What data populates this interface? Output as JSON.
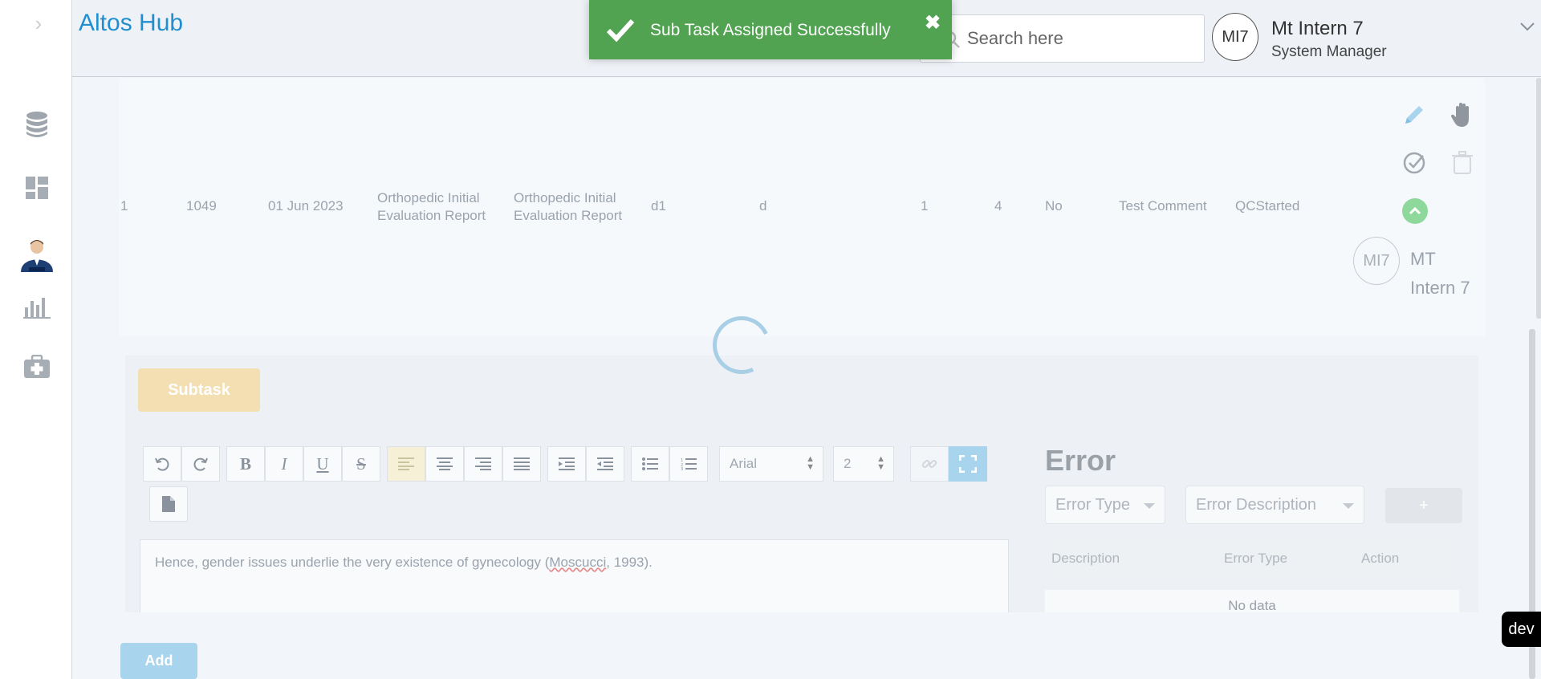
{
  "sidebar": {
    "toggle_icon": "chevron-right-icon",
    "items": [
      {
        "icon": "database-icon"
      },
      {
        "icon": "dashboard-icon"
      },
      {
        "icon": "doctor-avatar-icon",
        "active": true
      },
      {
        "icon": "bar-chart-icon"
      },
      {
        "icon": "medical-kit-icon"
      }
    ]
  },
  "header": {
    "brand": "Altos Hub",
    "search": {
      "placeholder": "Search here",
      "value": ""
    },
    "user": {
      "initials": "MI7",
      "name": "Mt Intern 7",
      "role": "System Manager"
    }
  },
  "toast": {
    "message": "Sub Task Assigned Successfully",
    "close": "✖"
  },
  "task_row": {
    "cells": [
      "1",
      "1049",
      "01 Jun 2023",
      "Orthopedic Initial Evaluation Report",
      "Orthopedic Initial Evaluation Report",
      "d1",
      "d",
      "1",
      "4",
      "No",
      "Test Comment",
      "QCStarted"
    ],
    "assignee": {
      "initials": "MI7",
      "name": "MT Intern 7"
    },
    "actions": [
      "edit-icon",
      "hand-icon",
      "check-circle-icon",
      "trash-icon",
      "chevron-up-icon"
    ]
  },
  "subtask": {
    "button_label": "Subtask",
    "editor": {
      "font": "Arial",
      "size": "2",
      "content_before": "Hence, gender issues underlie the very existence of gynecology (",
      "content_underlined": "Moscucci",
      "content_after": ", 1993)."
    }
  },
  "error_panel": {
    "title": "Error",
    "error_type_placeholder": "Error Type",
    "error_description_placeholder": "Error Description",
    "add_label": "+",
    "columns": [
      "Description",
      "Error Type",
      "Action"
    ],
    "empty_text": "No data"
  },
  "footer": {
    "add_label": "Add"
  },
  "env_badge": "dev",
  "colors": {
    "brand": "#1f8fcf",
    "toast": "#51a351",
    "subtask": "#f4dfb2",
    "add": "#a8d4ed",
    "action_green": "#8fd89b"
  }
}
